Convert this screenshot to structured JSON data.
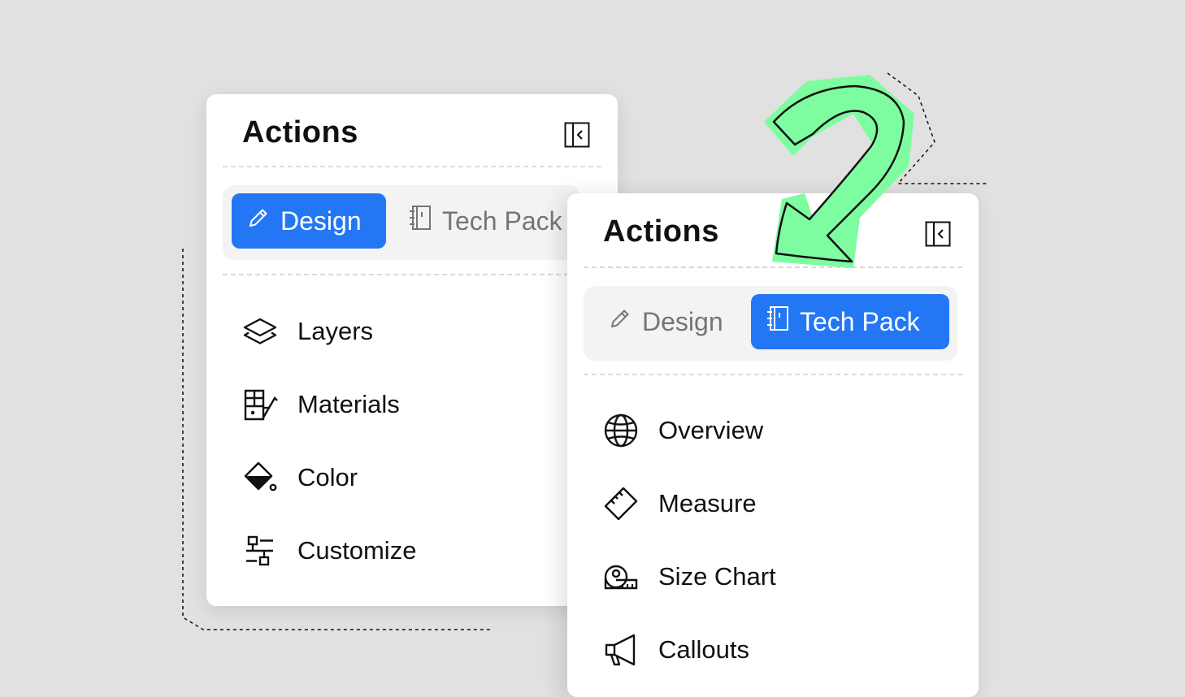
{
  "panel_a": {
    "title": "Actions",
    "tabs": [
      {
        "label": "Design",
        "icon": "pencil-icon",
        "active": true
      },
      {
        "label": "Tech Pack",
        "icon": "notebook-icon",
        "active": false
      }
    ],
    "items": [
      {
        "label": "Layers",
        "icon": "layers-icon"
      },
      {
        "label": "Materials",
        "icon": "materials-icon"
      },
      {
        "label": "Color",
        "icon": "paint-bucket-icon"
      },
      {
        "label": "Customize",
        "icon": "customize-icon"
      }
    ]
  },
  "panel_b": {
    "title": "Actions",
    "tabs": [
      {
        "label": "Design",
        "icon": "pencil-icon",
        "active": false
      },
      {
        "label": "Tech Pack",
        "icon": "notebook-icon",
        "active": true
      }
    ],
    "items": [
      {
        "label": "Overview",
        "icon": "globe-icon"
      },
      {
        "label": "Measure",
        "icon": "ruler-icon"
      },
      {
        "label": "Size Chart",
        "icon": "tape-measure-icon"
      },
      {
        "label": "Callouts",
        "icon": "megaphone-icon"
      }
    ]
  },
  "colors": {
    "background": "#e1e1e1",
    "accent": "#2377f4",
    "arrow_green": "#7dfda0",
    "segment_bg": "#f3f3f3"
  }
}
